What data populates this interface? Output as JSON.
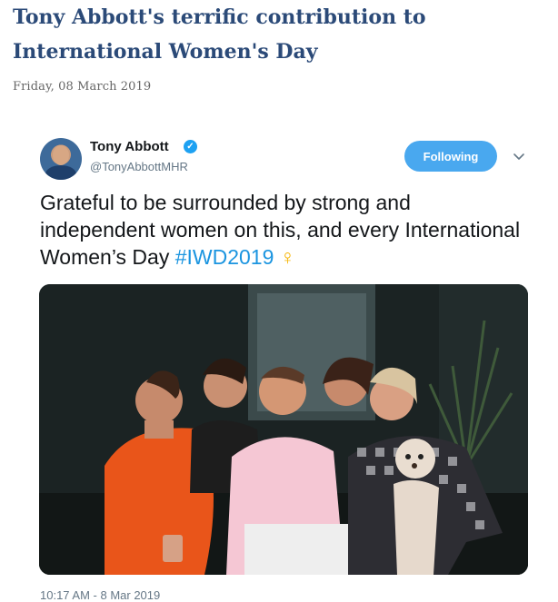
{
  "article": {
    "title": "Tony Abbott's terrific contribution to International Women's Day",
    "date": "Friday, 08 March 2019"
  },
  "tweet": {
    "author_name": "Tony Abbott",
    "handle": "@TonyAbbottMHR",
    "verified_icon": "verified-badge-icon",
    "follow_label": "Following",
    "menu_icon": "chevron-down-icon",
    "text_main": "Grateful to be surrounded by strong and independent women on this, and every International Women’s Day ",
    "hashtag": "#IWD2019",
    "emoji": "♀",
    "timestamp": "10:17 AM - 8 Mar 2019",
    "photo_icon": "group-photo-image"
  },
  "colors": {
    "title": "#2b4a78",
    "follow_button": "#49a8ef",
    "hashtag": "#1b95e0",
    "venus": "#f6b400"
  }
}
